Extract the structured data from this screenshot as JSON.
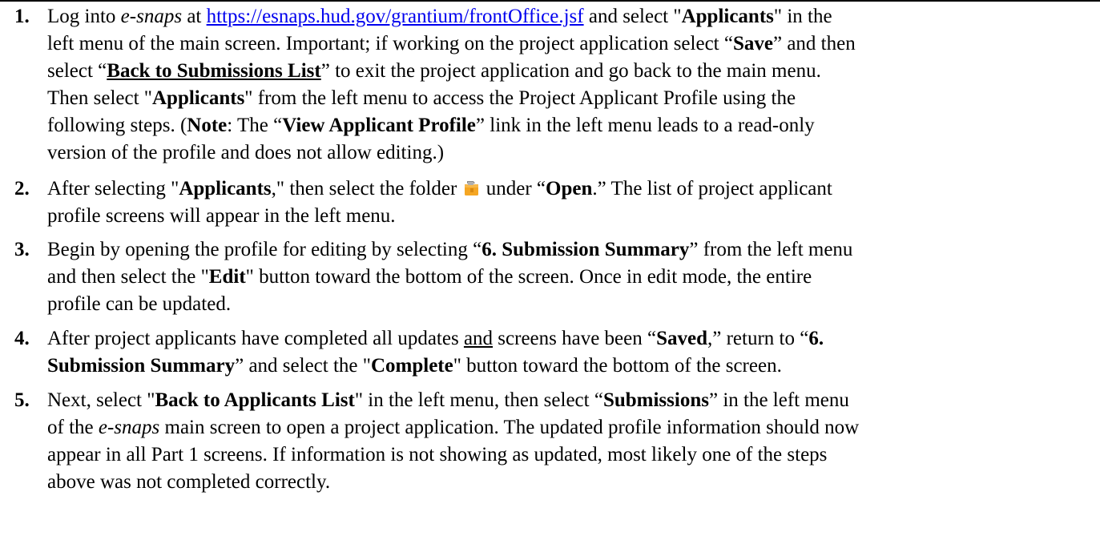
{
  "steps": [
    {
      "number": "1.",
      "lines": [
        {
          "a": "Log into ",
          "b": "e-snaps",
          "c": " at ",
          "link": "https://esnaps.hud.gov/grantium/frontOffice.jsf",
          "d": " and select \"",
          "e": "Applicants",
          "f": "\" in the"
        },
        {
          "a": "left menu of the main screen. Important; if working on the project application select “",
          "b": "Save",
          "c": "” and then"
        },
        {
          "a": "select “",
          "b": "Back to Submissions List",
          "c": "” to exit the project application and go back to the main menu."
        },
        {
          "a": "Then select \"",
          "b": "Applicants",
          "c": "\" from the left menu to access the Project Applicant Profile using the"
        },
        {
          "a": "following steps. (",
          "b": "Note",
          "c": ": The “",
          "d": "View Applicant Profile",
          "e": "” link in the left menu leads to a read-only"
        },
        {
          "a": "version of the profile and does not allow editing.)"
        }
      ]
    },
    {
      "number": "2.",
      "lines": [
        {
          "a": "After selecting \"",
          "b": "Applicants",
          "c": ",\" then select the folder ",
          "d": " under “",
          "e": "Open",
          "f": ".” The list of project applicant"
        },
        {
          "a": "profile screens will appear in the left menu."
        }
      ]
    },
    {
      "number": "3.",
      "lines": [
        {
          "a": "Begin by opening the profile for editing by selecting “",
          "b": "6. Submission Summary",
          "c": "” from the left menu"
        },
        {
          "a": "and then select the \"",
          "b": "Edit",
          "c": "\" button toward the bottom of the screen. Once in edit mode, the entire"
        },
        {
          "a": "profile can be updated."
        }
      ]
    },
    {
      "number": "4.",
      "lines": [
        {
          "a": "After project applicants have completed all updates ",
          "b": "and",
          "c": " screens have been “",
          "d": "Saved",
          "e": ",” return to “",
          "f": "6."
        },
        {
          "a": "Submission Summary",
          "b": "” and select the \"",
          "c": "Complete",
          "d": "\" button toward the bottom of the screen."
        }
      ]
    },
    {
      "number": "5.",
      "lines": [
        {
          "a": "Next, select \"",
          "b": "Back to Applicants List",
          "c": "\" in the left menu, then select “",
          "d": "Submissions",
          "e": "” in the left menu"
        },
        {
          "a": "of the ",
          "b": "e-snaps",
          "c": " main screen to open a project application. The updated profile information should now"
        },
        {
          "a": "appear in all Part 1 screens. If information is not showing as updated, most likely one of the steps"
        },
        {
          "a": "above was not completed correctly."
        }
      ]
    }
  ],
  "icons": {
    "folder": "folder-icon"
  },
  "colors": {
    "link": "#0000ee",
    "folder_body": "#f5a623",
    "folder_tab": "#8a8a8a"
  }
}
